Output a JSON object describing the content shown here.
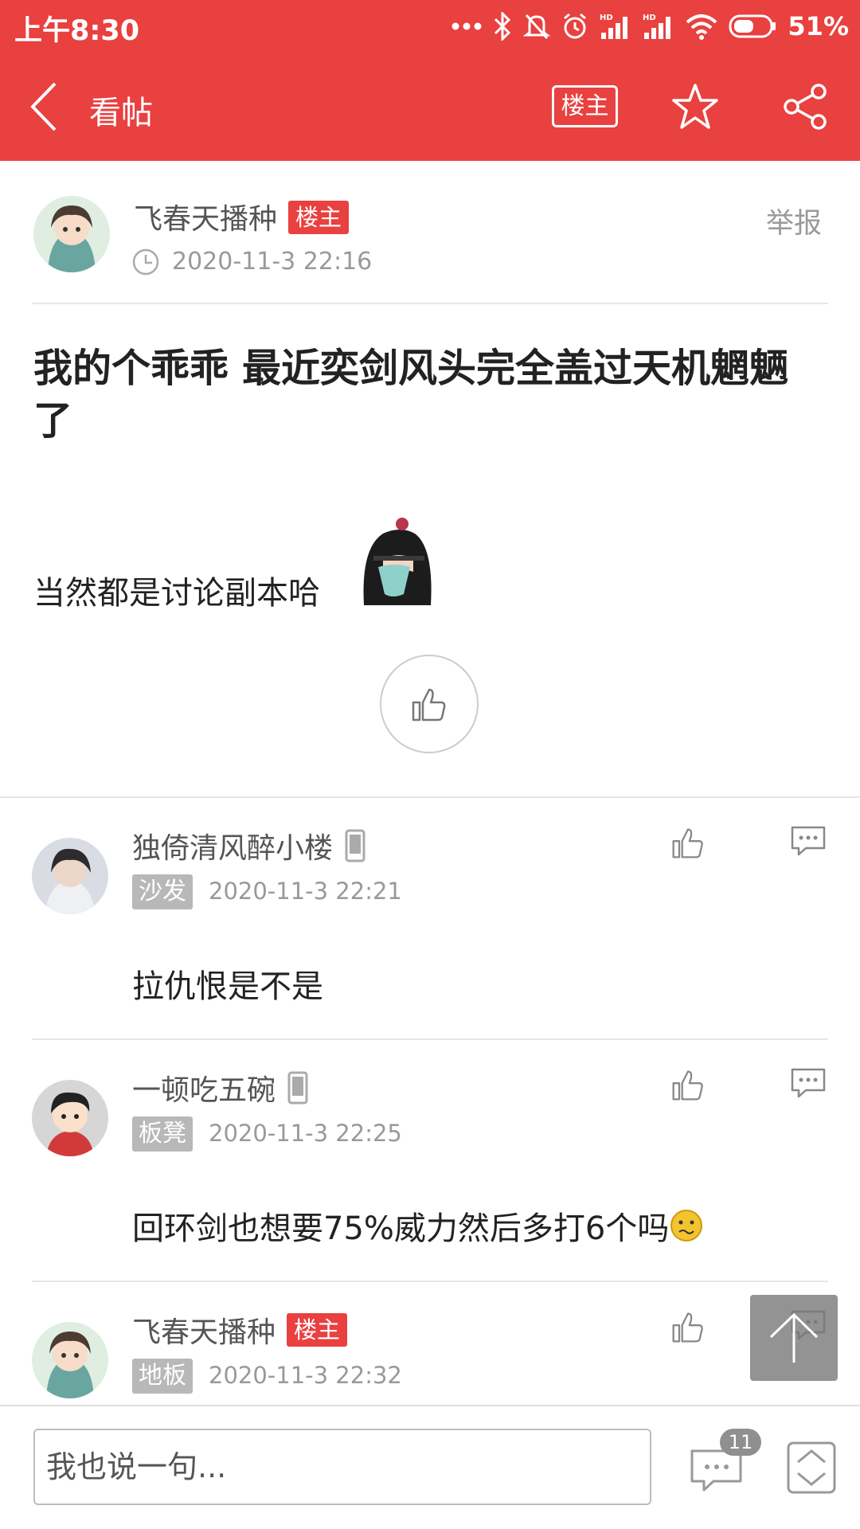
{
  "status_bar": {
    "time": "上午8:30",
    "battery": "51%"
  },
  "title_bar": {
    "title": "看帖",
    "op_only_label": "楼主"
  },
  "post": {
    "author": "飞春天播种",
    "author_tag": "楼主",
    "time": "2020-11-3 22:16",
    "report_label": "举报",
    "title": "我的个乖乖 最近奕剑风头完全盖过天机魍魉了",
    "body": "当然都是讨论副本哈"
  },
  "replies": [
    {
      "author": "独倚清风醉小楼",
      "floor": "沙发",
      "time": "2020-11-3 22:21",
      "content": "拉仇恨是不是",
      "device_icon": "phone-icon"
    },
    {
      "author": "一顿吃五碗",
      "floor": "板凳",
      "time": "2020-11-3 22:25",
      "content": "回环剑也想要75%威力然后多打6个吗",
      "device_icon": "phone-icon"
    },
    {
      "author": "飞春天播种",
      "author_tag": "楼主",
      "floor": "地板",
      "time": "2020-11-3 22:32"
    }
  ],
  "bottom_bar": {
    "input_placeholder": "我也说一句...",
    "comment_count": "11"
  },
  "colors": {
    "brand": "#e94040",
    "floor_tag": "#b8b8b8",
    "muted_text": "#999999"
  }
}
